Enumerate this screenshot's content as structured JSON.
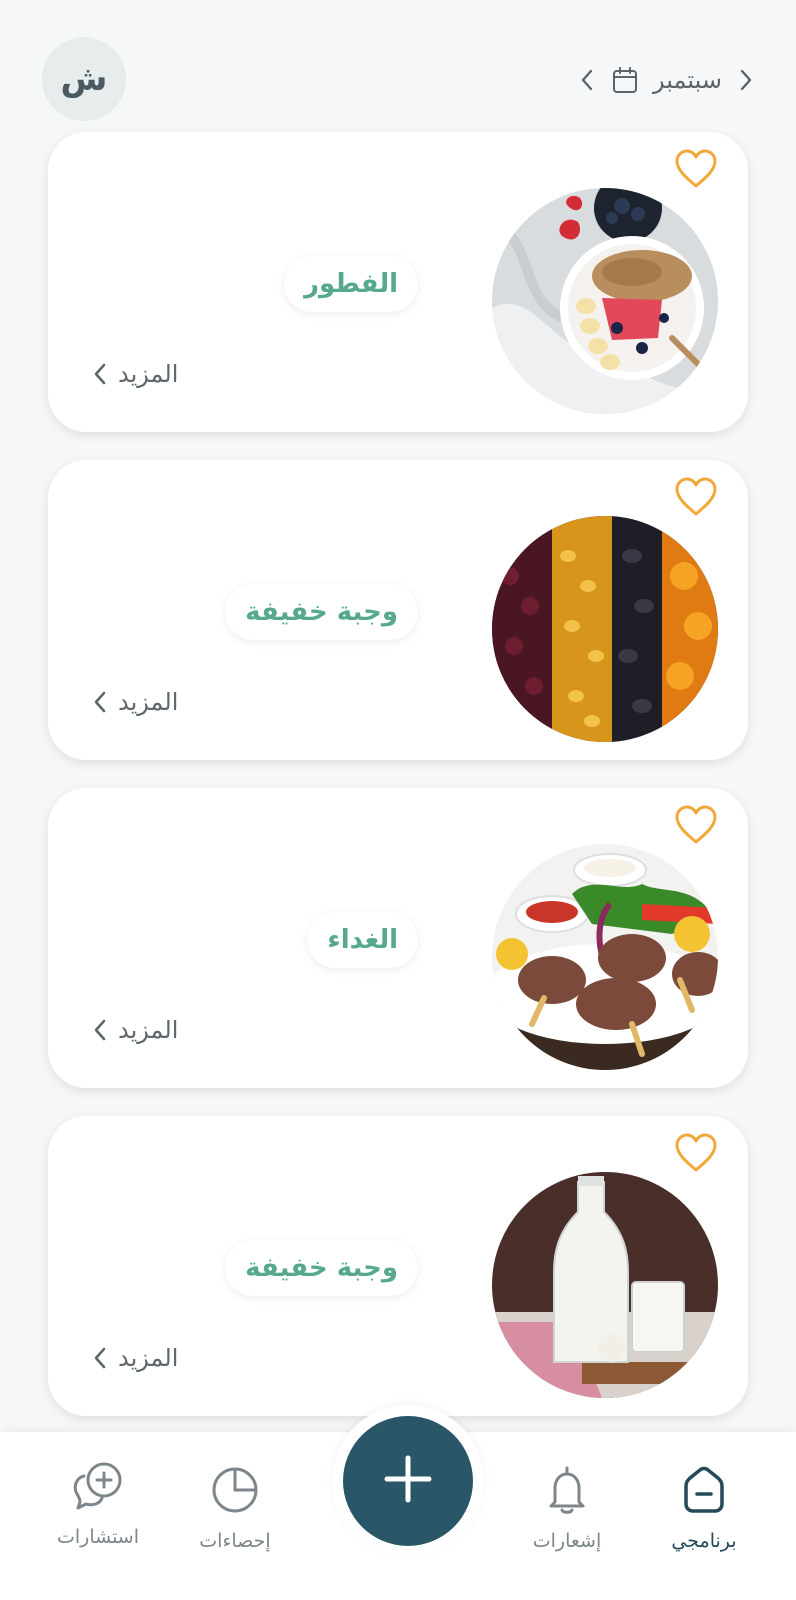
{
  "header": {
    "avatar_initial": "ش",
    "month": "سبتمبر"
  },
  "meals": [
    {
      "label": "الفطور",
      "more": "المزيد",
      "photo": "yogurt-fruit-bowl"
    },
    {
      "label": "وجبة خفيفة",
      "more": "المزيد",
      "photo": "dried-fruits"
    },
    {
      "label": "الغداء",
      "more": "المزيد",
      "photo": "kofta-skewers"
    },
    {
      "label": "وجبة خفيفة",
      "more": "المزيد",
      "photo": "milk-bottle"
    }
  ],
  "nav": {
    "home": "برنامجي",
    "notifications": "إشعارات",
    "stats": "إحصاءات",
    "consultations": "استشارات"
  },
  "colors": {
    "accent_green": "#56a98d",
    "primary": "#295767",
    "heart": "#f2a93b"
  }
}
